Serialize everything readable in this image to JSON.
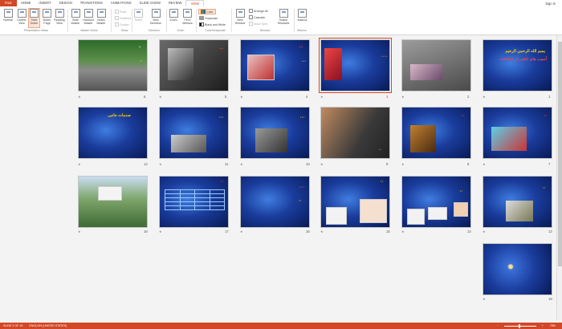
{
  "tabs": [
    "FILE",
    "HOME",
    "INSERT",
    "DESIGN",
    "TRANSITIONS",
    "ANIMATIONS",
    "SLIDE SHOW",
    "REVIEW",
    "VIEW"
  ],
  "sign_in": "Sign in",
  "ribbon": {
    "presentation_views": [
      "Normal",
      "Outline View",
      "Slide Sorter",
      "Notes Page",
      "Reading View"
    ],
    "master_views": [
      "Slide Master",
      "Handout Master",
      "Notes Master"
    ],
    "show": [
      "Ruler",
      "Gridlines",
      "Guides",
      "Notes"
    ],
    "show_group2": [
      "View Direction"
    ],
    "zoom": [
      "Zoom",
      "Fit to Window"
    ],
    "color": [
      "Color",
      "Grayscale",
      "Black and White"
    ],
    "window": [
      "New Window",
      "Arrange All",
      "Cascade",
      "Move Split",
      "Switch Windows"
    ],
    "macros": [
      "Macros"
    ],
    "group_labels": [
      "Presentation Views",
      "Master Views",
      "Show",
      "Direction",
      "Zoom",
      "Color/Grayscale",
      "Window",
      "Macros"
    ]
  },
  "slides": {
    "n1": "1",
    "n2": "2",
    "n3": "3",
    "n4": "4",
    "n5": "5",
    "n6": "6",
    "n7": "7",
    "n8": "8",
    "n9": "9",
    "n10": "10",
    "n11": "11",
    "n12": "12",
    "n13": "13",
    "n14": "14",
    "n15": "15",
    "n16": "16",
    "n17": "17",
    "n18": "18",
    "n19": "19",
    "s1": {
      "line1": "بسم الله الرحمن الرحيم",
      "line2": "آسیب های ناشی از تصادفات"
    },
    "s3": {
      "body": "• • • •"
    },
    "s4": {
      "title": "• •",
      "body": "• • •"
    },
    "s5": {
      "title": "• •"
    },
    "s6": {
      "title": "•",
      "body": "• •"
    },
    "s7": {
      "title": "• •"
    },
    "s8": {
      "title": "• •"
    },
    "s9": {
      "caption": "• •"
    },
    "s10": {
      "body": "• • •"
    },
    "s11": {
      "body": "• • •"
    },
    "s12": {
      "title": "صدمات جانبی"
    },
    "s13": {
      "body": "• •"
    },
    "s14": {
      "body": "• •"
    },
    "s15": {
      "title": "• •"
    },
    "s16": {
      "title": "• • •",
      "body": "• •"
    },
    "s17": {
      "title": "• •"
    }
  },
  "status": {
    "slide_counter": "SLIDE 3 OF 19",
    "language": "ENGLISH (UNITED STATES)",
    "zoom": "78%"
  }
}
